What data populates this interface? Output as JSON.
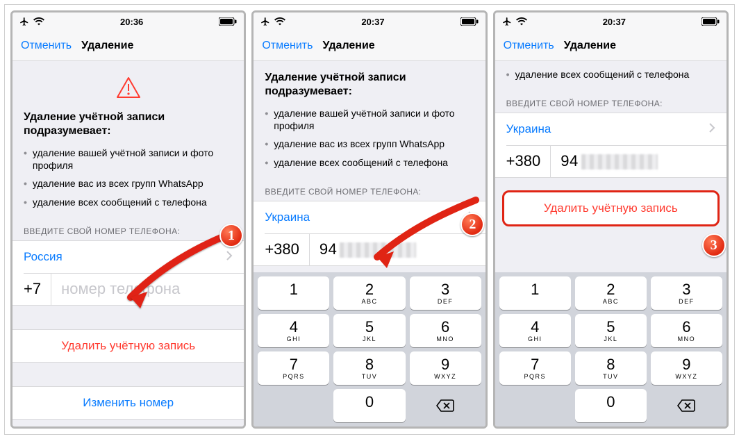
{
  "status": {
    "time1": "20:36",
    "time2": "20:37",
    "time3": "20:37"
  },
  "nav": {
    "cancel": "Отменить",
    "title": "Удаление"
  },
  "heading": "Удаление учётной записи подразумевает:",
  "bullets": [
    "удаление вашей учётной записи и фото профиля",
    "удаление вас из всех групп WhatsApp",
    "удаление всех сообщений с телефона"
  ],
  "section_label": "ВВЕДИТЕ СВОЙ НОМЕР ТЕЛЕФОНА:",
  "screens": {
    "a": {
      "country": "Россия",
      "code": "+7",
      "placeholder": "номер телефона"
    },
    "b": {
      "country": "Украина",
      "code": "+380",
      "number_visible": "94"
    },
    "c": {
      "country": "Украина",
      "code": "+380",
      "number_visible": "94"
    }
  },
  "actions": {
    "delete": "Удалить учётную запись",
    "change": "Изменить номер"
  },
  "keypad": [
    {
      "d": "1",
      "s": ""
    },
    {
      "d": "2",
      "s": "ABC"
    },
    {
      "d": "3",
      "s": "DEF"
    },
    {
      "d": "4",
      "s": "GHI"
    },
    {
      "d": "5",
      "s": "JKL"
    },
    {
      "d": "6",
      "s": "MNO"
    },
    {
      "d": "7",
      "s": "PQRS"
    },
    {
      "d": "8",
      "s": "TUV"
    },
    {
      "d": "9",
      "s": "WXYZ"
    },
    {
      "d": "",
      "s": ""
    },
    {
      "d": "0",
      "s": ""
    },
    {
      "d": "del",
      "s": ""
    }
  ],
  "badges": {
    "one": "1",
    "two": "2",
    "three": "3"
  },
  "colors": {
    "ios_blue": "#0a7cff",
    "ios_red": "#ff3b30",
    "anno_red": "#e02414"
  }
}
